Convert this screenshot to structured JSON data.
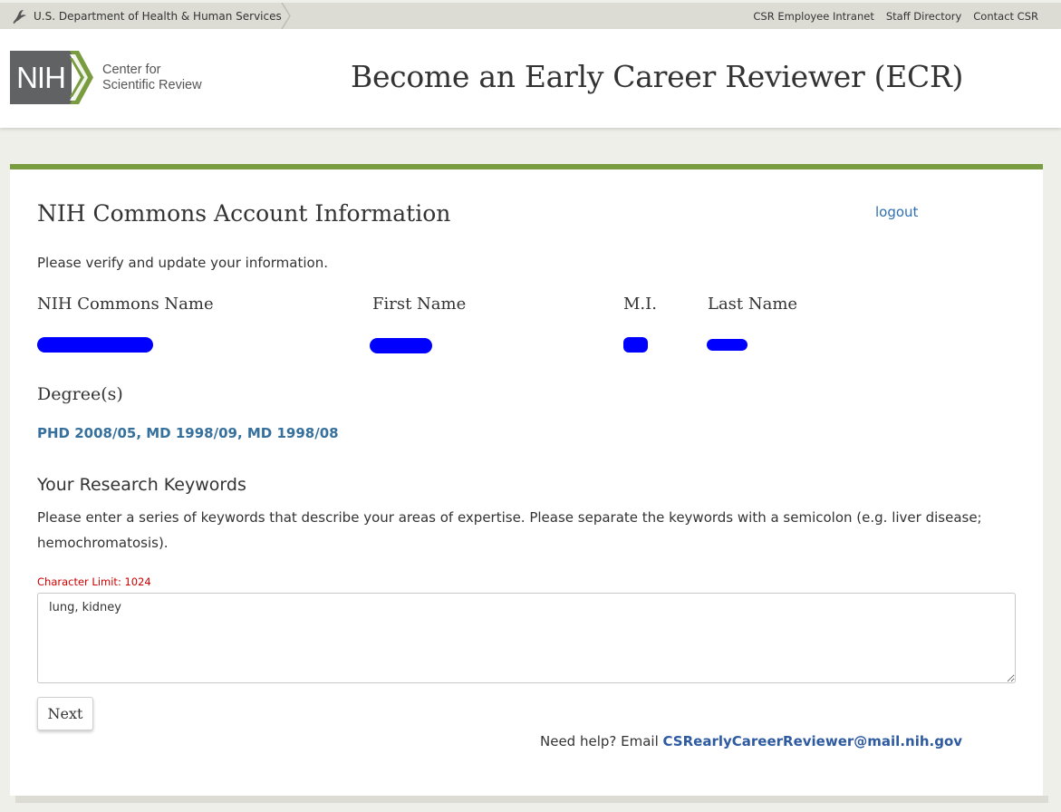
{
  "topbar": {
    "agency": "U.S. Department of Health & Human Services",
    "links": [
      "CSR Employee Intranet",
      "Staff Directory",
      "Contact CSR"
    ]
  },
  "header": {
    "logo_mark": "NIH",
    "logo_text_line1": "Center for",
    "logo_text_line2": "Scientific Review",
    "title": "Become an Early Career Reviewer (ECR)"
  },
  "card": {
    "section_title": "NIH Commons Account Information",
    "logout_label": "logout",
    "verify_text": "Please verify and update your information.",
    "fields": {
      "commons_name_label": "NIH Commons Name",
      "first_name_label": "First Name",
      "mi_label": "M.I.",
      "last_name_label": "Last Name"
    },
    "degree_label": "Degree(s)",
    "degree_value": "PHD 2008/05, MD 1998/09, MD 1998/08",
    "keywords_title": "Your Research Keywords",
    "keywords_desc": "Please enter a series of keywords that describe your areas of expertise. Please separate the keywords with a semicolon (e.g. liver disease; hemochromatosis).",
    "char_limit": "Character Limit: 1024",
    "keywords_value": "lung, kidney",
    "next_label": "Next",
    "help_prefix": "Need help? Email ",
    "help_email": "CSRearlyCareerReviewer@mail.nih.gov"
  },
  "colors": {
    "accent_green": "#7a9c40",
    "link_blue": "#2f6fb0",
    "degree_blue": "#36709c",
    "redaction": "#0000ff",
    "limit_red": "#cc0000"
  }
}
